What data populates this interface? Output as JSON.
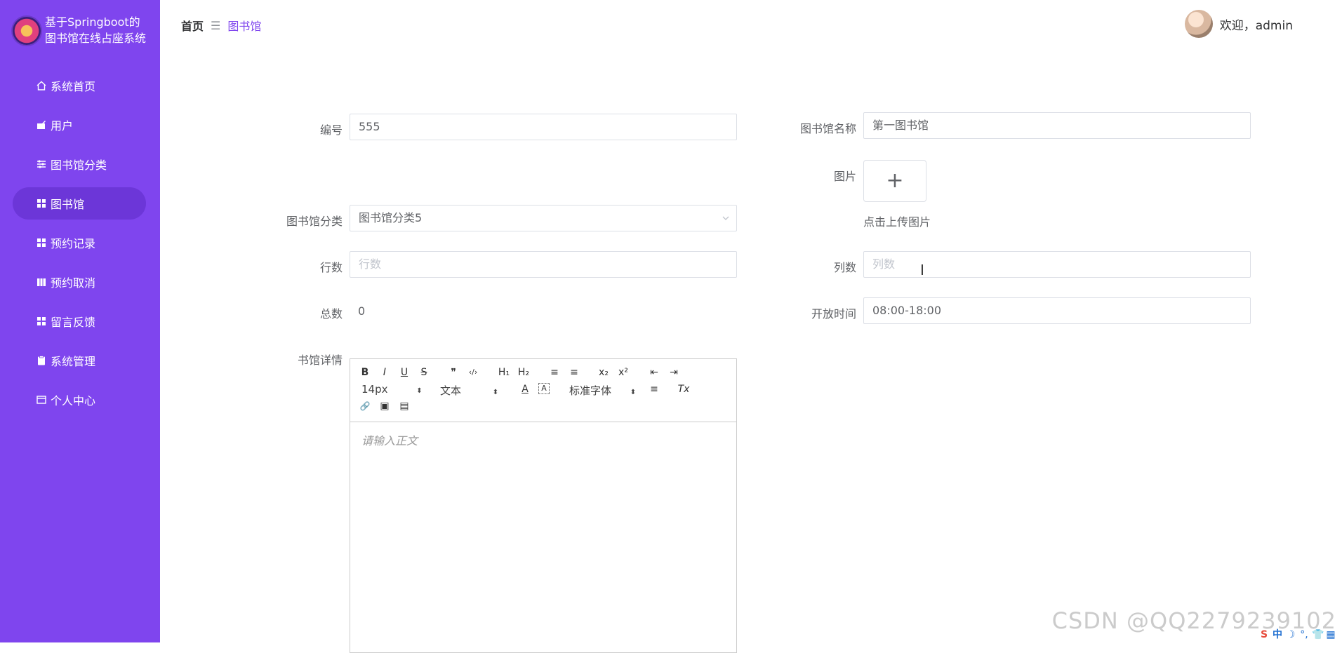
{
  "brand": {
    "title_line1": "基于Springboot的",
    "title_line2": "图书馆在线占座系统"
  },
  "sidebar": {
    "items": [
      {
        "label": "系统首页",
        "icon": "home-icon"
      },
      {
        "label": "用户",
        "icon": "user-icon"
      },
      {
        "label": "图书馆分类",
        "icon": "sliders-icon"
      },
      {
        "label": "图书馆",
        "icon": "grid-icon",
        "active": true
      },
      {
        "label": "预约记录",
        "icon": "grid-icon"
      },
      {
        "label": "预约取消",
        "icon": "bars-icon"
      },
      {
        "label": "留言反馈",
        "icon": "grid-icon"
      },
      {
        "label": "系统管理",
        "icon": "clipboard-icon"
      },
      {
        "label": "个人中心",
        "icon": "card-icon"
      }
    ],
    "bg_color": "#7f45ee",
    "active_color": "#6c36d8"
  },
  "header": {
    "breadcrumb": {
      "home": "首页",
      "separator": "☰",
      "current": "图书馆"
    },
    "welcome": "欢迎，admin"
  },
  "form": {
    "number": {
      "label": "编号",
      "value": "555"
    },
    "library_name": {
      "label": "图书馆名称",
      "value": "第一图书馆"
    },
    "image": {
      "label": "图片",
      "hint": "点击上传图片",
      "plus": "+"
    },
    "category": {
      "label": "图书馆分类",
      "value": "图书馆分类5"
    },
    "rows": {
      "label": "行数",
      "placeholder": "行数"
    },
    "cols": {
      "label": "列数",
      "placeholder": "列数"
    },
    "total": {
      "label": "总数",
      "value": "0"
    },
    "open_time": {
      "label": "开放时间",
      "value": "08:00-18:00"
    },
    "detail": {
      "label": "书馆详情"
    }
  },
  "editor": {
    "font_size": "14px",
    "paragraph": "文本",
    "font_family": "标准字体",
    "placeholder": "请输入正文",
    "btn_bold": "B",
    "btn_italic": "I",
    "btn_underline": "U",
    "btn_strike": "S",
    "btn_quote": "❞",
    "btn_code": "‹/›",
    "btn_h1": "H₁",
    "btn_h2": "H₂",
    "btn_ol": "≡",
    "btn_ul": "≡",
    "btn_sub": "x₂",
    "btn_sup": "x²",
    "btn_outdent": "⇤",
    "btn_indent": "⇥",
    "btn_color": "A",
    "btn_bg": "A",
    "btn_align": "≡",
    "btn_clean": "Tx",
    "btn_link": "🔗",
    "btn_image": "▣",
    "btn_video": "▤"
  },
  "watermark": "CSDN @QQ2279239102",
  "tray": [
    "S",
    "中",
    "☽",
    "°,",
    "👕",
    "▦"
  ]
}
